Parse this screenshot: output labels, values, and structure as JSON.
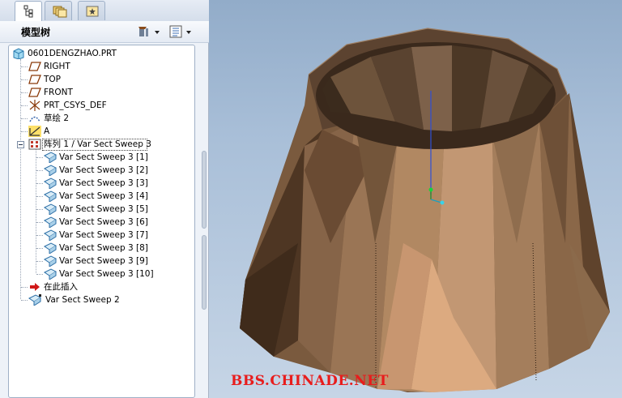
{
  "tabs": [
    {
      "name": "model-tree",
      "icon": "model-tree-tab-icon",
      "active": true
    },
    {
      "name": "folder-browser",
      "icon": "folder-browser-tab-icon",
      "active": false
    },
    {
      "name": "favorites",
      "icon": "favorites-tab-icon",
      "active": false
    }
  ],
  "header": {
    "title": "模型树",
    "tools_icon": "tools-icon",
    "settings_icon": "tree-settings-icon"
  },
  "tree": {
    "root": "0601DENGZHAO.PRT",
    "items": [
      {
        "label": "RIGHT",
        "icon": "datum-plane-icon"
      },
      {
        "label": "TOP",
        "icon": "datum-plane-icon"
      },
      {
        "label": "FRONT",
        "icon": "datum-plane-icon"
      },
      {
        "label": "PRT_CSYS_DEF",
        "icon": "csys-icon"
      },
      {
        "label": "草绘 2",
        "icon": "sketch-icon"
      },
      {
        "label": "A",
        "icon": "datum-axis-icon"
      }
    ],
    "pattern": {
      "label": "阵列 1 / Var Sect Sweep 3",
      "icon": "pattern-icon",
      "expanded": true
    },
    "pattern_children": [
      "Var Sect Sweep 3 [1]",
      "Var Sect Sweep 3 [2]",
      "Var Sect Sweep 3 [3]",
      "Var Sect Sweep 3 [4]",
      "Var Sect Sweep 3 [5]",
      "Var Sect Sweep 3 [6]",
      "Var Sect Sweep 3 [7]",
      "Var Sect Sweep 3 [8]",
      "Var Sect Sweep 3 [9]",
      "Var Sect Sweep 3 [10]"
    ],
    "insert_here": "在此插入",
    "after": {
      "label": "Var Sect Sweep 2",
      "icon": "var-sect-sweep-icon"
    }
  },
  "viewport": {
    "watermark": "BBS.CHINADE.NET",
    "background_top": "#92acc9",
    "background_bottom": "#c6d5e6",
    "model_color": "#a07e5c"
  }
}
